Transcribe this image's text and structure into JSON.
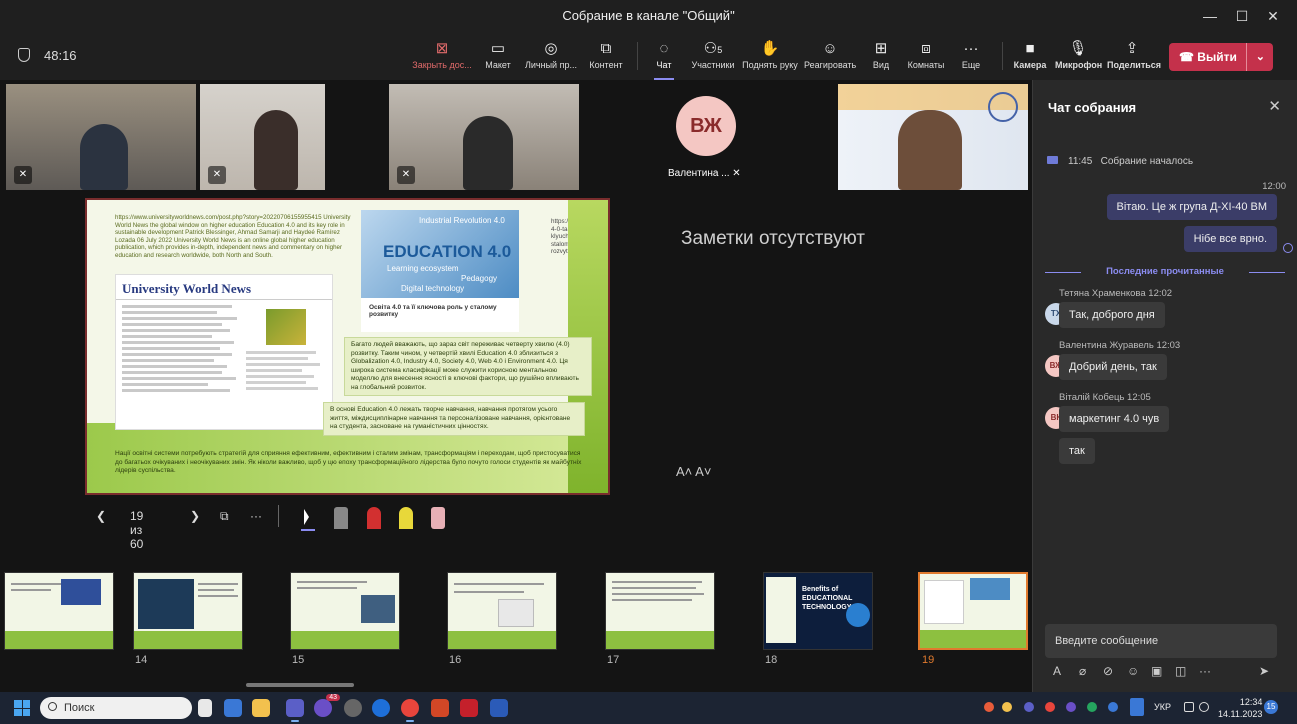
{
  "window": {
    "title": "Собрание в канале \"Общий\""
  },
  "toolbar": {
    "timer": "48:16",
    "items": [
      {
        "label": "Закрыть дос...",
        "icon": "close-share-icon"
      },
      {
        "label": "Макет",
        "icon": "layout-icon"
      },
      {
        "label": "Личный пр...",
        "icon": "eye-icon"
      },
      {
        "label": "Контент",
        "icon": "content-icon"
      },
      {
        "label": "Чат",
        "icon": "chat-icon"
      },
      {
        "label": "Участники",
        "icon": "people-icon",
        "count": "5"
      },
      {
        "label": "Поднять руку",
        "icon": "hand-icon"
      },
      {
        "label": "Реагировать",
        "icon": "smile-icon"
      },
      {
        "label": "Вид",
        "icon": "view-icon"
      },
      {
        "label": "Комнаты",
        "icon": "rooms-icon"
      },
      {
        "label": "Еще",
        "icon": "more-icon"
      },
      {
        "label": "Камера",
        "icon": "camera-icon"
      },
      {
        "label": "Микрофон",
        "icon": "mic-icon"
      },
      {
        "label": "Поделиться",
        "icon": "share-icon"
      }
    ],
    "leave_label": "Выйти"
  },
  "participants": {
    "avatar_initials": "ВЖ",
    "avatar_name": "Валентина ..."
  },
  "slide": {
    "url_block": "https://www.universityworldnews.com/post.php?story=20220706155955415 University World News the global window on higher education Education 4.0 and its key role in sustainable development Patrick Blessinger, Ahmad Samarji and Haydeé Ramírez Lozada 06 July 2022 University World News is an online global higher education publication, which provides in-depth, independent news and commentary on higher education and research worldwide, both North and South.",
    "uwn_logo": "University World News",
    "edu_title": "EDUCATION 4.0",
    "edu_sub1": "Learning ecosystem",
    "edu_sub2": "Pedagogy",
    "edu_sub3": "Digital technology",
    "edu_top": "Industrial Revolution 4.0",
    "card_title": "Освіта 4.0 та її ключова роль у сталому розвитку",
    "url2": "https://foreu.kpi.ua/osvita-4-0-ta-yiyi-klyuchova-rol-u-stalomu-rozvytkuESTMIP58C",
    "para1": "Багато людей вважають, що зараз світ переживає четверту хвилю (4.0) розвитку. Таким чином, у четвертій хвилі Education 4.0 зблизиться з Globalization 4.0, Industry 4.0, Society 4.0, Web 4.0 і Environment 4.0. Ця широка система класифікації може служити корисною ментальною моделлю для внесення ясності в ключові фактори, що рушійно впливають на глобальний розвиток.",
    "para2": "В основі Education 4.0 лежать творче навчання, навчання протягом усього життя, міждисциплінарне навчання та персоналізоване навчання, орієнтоване на студента, засноване на гуманістичних цінностях.",
    "para3": "Нації освітні системи потребують стратегій для сприяння ефективним, ефективним і сталим змінам, трансформаціям і переходам, щоб пристосуватися до багатьох очікуваних і неочікуваних змін. Як ніколи важливо, щоб у цю епоху трансформаційного лідерства було почуто голоси студентів як майбутніх лідерів суспільства."
  },
  "notes": {
    "empty_label": "Заметки отсутствуют",
    "font_controls": "A˄ A˅"
  },
  "slide_nav": {
    "counter": "19 из 60"
  },
  "thumbnails": [
    {
      "number": ""
    },
    {
      "number": "14"
    },
    {
      "number": "15"
    },
    {
      "number": "16"
    },
    {
      "number": "17"
    },
    {
      "number": "18"
    },
    {
      "number": "19"
    }
  ],
  "thumb18_title": "Benefits of EDUCATIONAL TECHNOLOGY",
  "chat": {
    "title": "Чат собрания",
    "system_time": "11:45",
    "system_text": "Собрание началось",
    "my_time": "12:00",
    "my_messages": [
      "Вітаю. Це ж група Д-ХІ-40 ВМ",
      "Нібе все врно."
    ],
    "divider": "Последние прочитанные",
    "messages": [
      {
        "sender": "Тетяна Храменкова",
        "time": "12:02",
        "initials": "ТХ",
        "text": "Так, доброго дня"
      },
      {
        "sender": "Валентина Журавель",
        "time": "12:03",
        "initials": "ВЖ",
        "text": "Добрий день, так"
      },
      {
        "sender": "Віталій Кобець",
        "time": "12:05",
        "initials": "ВК",
        "text": "маркетинг 4.0 чув"
      }
    ],
    "extra_message": "так",
    "composer_placeholder": "Введите сообщение"
  },
  "taskbar": {
    "search_placeholder": "Поиск",
    "teams_badge": "43",
    "lang": "УКР",
    "time": "12:34",
    "date": "14.11.2023",
    "notif": "15"
  },
  "colors": {
    "accent": "#8b8cf0",
    "leave": "#c4314b",
    "slide_green": "#9cc94b"
  }
}
